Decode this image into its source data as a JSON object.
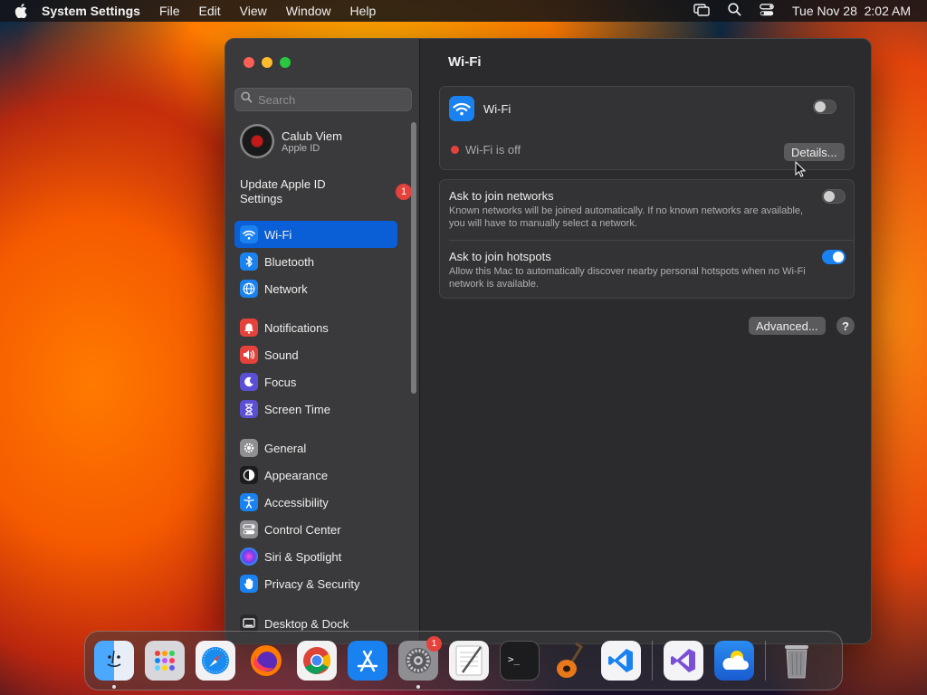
{
  "menubar": {
    "app_name": "System Settings",
    "menus": [
      "File",
      "Edit",
      "View",
      "Window",
      "Help"
    ],
    "clock": "Tue Nov 28  2:02 AM"
  },
  "sidebar": {
    "search_placeholder": "Search",
    "user": {
      "name": "Calub Viem",
      "subtitle": "Apple ID"
    },
    "update": {
      "label": "Update Apple ID Settings",
      "badge": "1"
    },
    "groups": [
      [
        {
          "label": "Wi-Fi",
          "icon": "wifi-icon",
          "color": "#1a82f0",
          "active": true
        },
        {
          "label": "Bluetooth",
          "icon": "bluetooth-icon",
          "color": "#1a82f0"
        },
        {
          "label": "Network",
          "icon": "globe-icon",
          "color": "#1a82f0"
        }
      ],
      [
        {
          "label": "Notifications",
          "icon": "bell-icon",
          "color": "#e5423b"
        },
        {
          "label": "Sound",
          "icon": "speaker-icon",
          "color": "#e5423b"
        },
        {
          "label": "Focus",
          "icon": "moon-icon",
          "color": "#5b4fd6"
        },
        {
          "label": "Screen Time",
          "icon": "hourglass-icon",
          "color": "#5b4fd6"
        }
      ],
      [
        {
          "label": "General",
          "icon": "gear-icon",
          "color": "#8e8e93"
        },
        {
          "label": "Appearance",
          "icon": "appearance-icon",
          "color": "#1c1c1e"
        },
        {
          "label": "Accessibility",
          "icon": "accessibility-icon",
          "color": "#1a82f0"
        },
        {
          "label": "Control Center",
          "icon": "control-center-icon",
          "color": "#8e8e93"
        },
        {
          "label": "Siri & Spotlight",
          "icon": "siri-icon",
          "color": "#3a2a6e"
        },
        {
          "label": "Privacy & Security",
          "icon": "hand-icon",
          "color": "#1a82f0"
        }
      ],
      [
        {
          "label": "Desktop & Dock",
          "icon": "desktop-icon",
          "color": "#2a2a2c"
        }
      ]
    ]
  },
  "main": {
    "title": "Wi-Fi",
    "wifi": {
      "label": "Wi-Fi",
      "enabled": false,
      "status": "Wi-Fi is off",
      "details_button": "Details..."
    },
    "settings": [
      {
        "title": "Ask to join networks",
        "description": "Known networks will be joined automatically. If no known networks are available, you will have to manually select a network.",
        "enabled": false
      },
      {
        "title": "Ask to join hotspots",
        "description": "Allow this Mac to automatically discover nearby personal hotspots when no Wi-Fi network is available.",
        "enabled": true
      }
    ],
    "advanced_button": "Advanced...",
    "help_button": "?"
  },
  "dock": {
    "apps": [
      {
        "name": "finder-icon",
        "color": "#2a8cf0",
        "running": true
      },
      {
        "name": "launchpad-icon",
        "color": "#d8d8dc"
      },
      {
        "name": "safari-icon",
        "color": "#f2f2f4"
      },
      {
        "name": "firefox-icon",
        "color": "#3a1a6e"
      },
      {
        "name": "chrome-icon",
        "color": "#f2f2f2"
      },
      {
        "name": "app-store-icon",
        "color": "#1a82f0"
      },
      {
        "name": "system-settings-icon",
        "color": "#8e8e93",
        "badge": "1",
        "running": true
      },
      {
        "name": "textedit-icon",
        "color": "#f2f2f2"
      },
      {
        "name": "terminal-icon",
        "color": "#1c1c1e"
      },
      {
        "name": "garageband-icon",
        "color": "#2a2a2c"
      },
      {
        "name": "vscode-icon",
        "color": "#f4f4f6"
      },
      {
        "name": "visual-studio-icon",
        "color": "#f4f4f6"
      },
      {
        "name": "weather-icon",
        "color": "#2a7ce0"
      },
      {
        "name": "trash-icon",
        "color": "transparent"
      }
    ]
  }
}
